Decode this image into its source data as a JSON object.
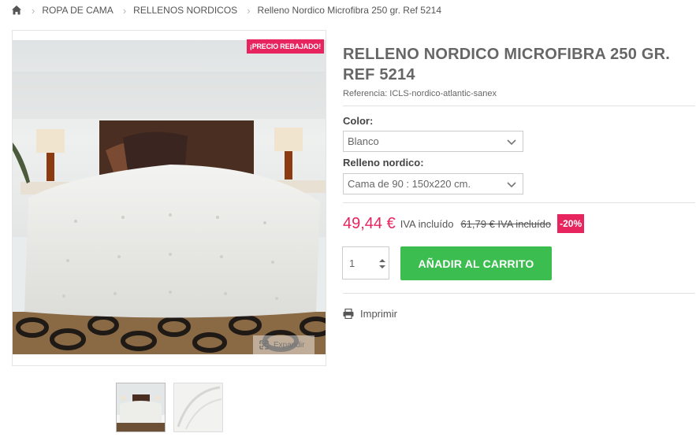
{
  "breadcrumb": {
    "home_icon": "home-icon",
    "items": [
      "ROPA DE CAMA",
      "RELLENOS NORDICOS",
      "Relleno Nordico Microfibra 250 gr. Ref 5214"
    ]
  },
  "gallery": {
    "sale_badge": "¡PRECIO REBAJADO!",
    "expand_label": "Expandir",
    "thumbnails": [
      "bed-photo-thumbnail",
      "quilt-detail-thumbnail"
    ]
  },
  "product": {
    "title": "RELLENO NORDICO MICROFIBRA 250 GR. REF 5214",
    "reference": "Referencia: ICLS-nordico-atlantic-sanex",
    "color_label": "Color:",
    "color_value": "Blanco",
    "fill_label": "Relleno nordico:",
    "fill_value": "Cama de 90 : 150x220 cm.",
    "price": "49,44 €",
    "price_tax": "IVA incluído",
    "old_price": "61,79 € IVA incluído",
    "discount": "-20%",
    "quantity": "1",
    "add_to_cart": "AÑADIR AL CARRITO",
    "print_label": "Imprimir"
  },
  "colors": {
    "accent_pink": "#e8245f",
    "cart_green": "#3bbd50"
  }
}
